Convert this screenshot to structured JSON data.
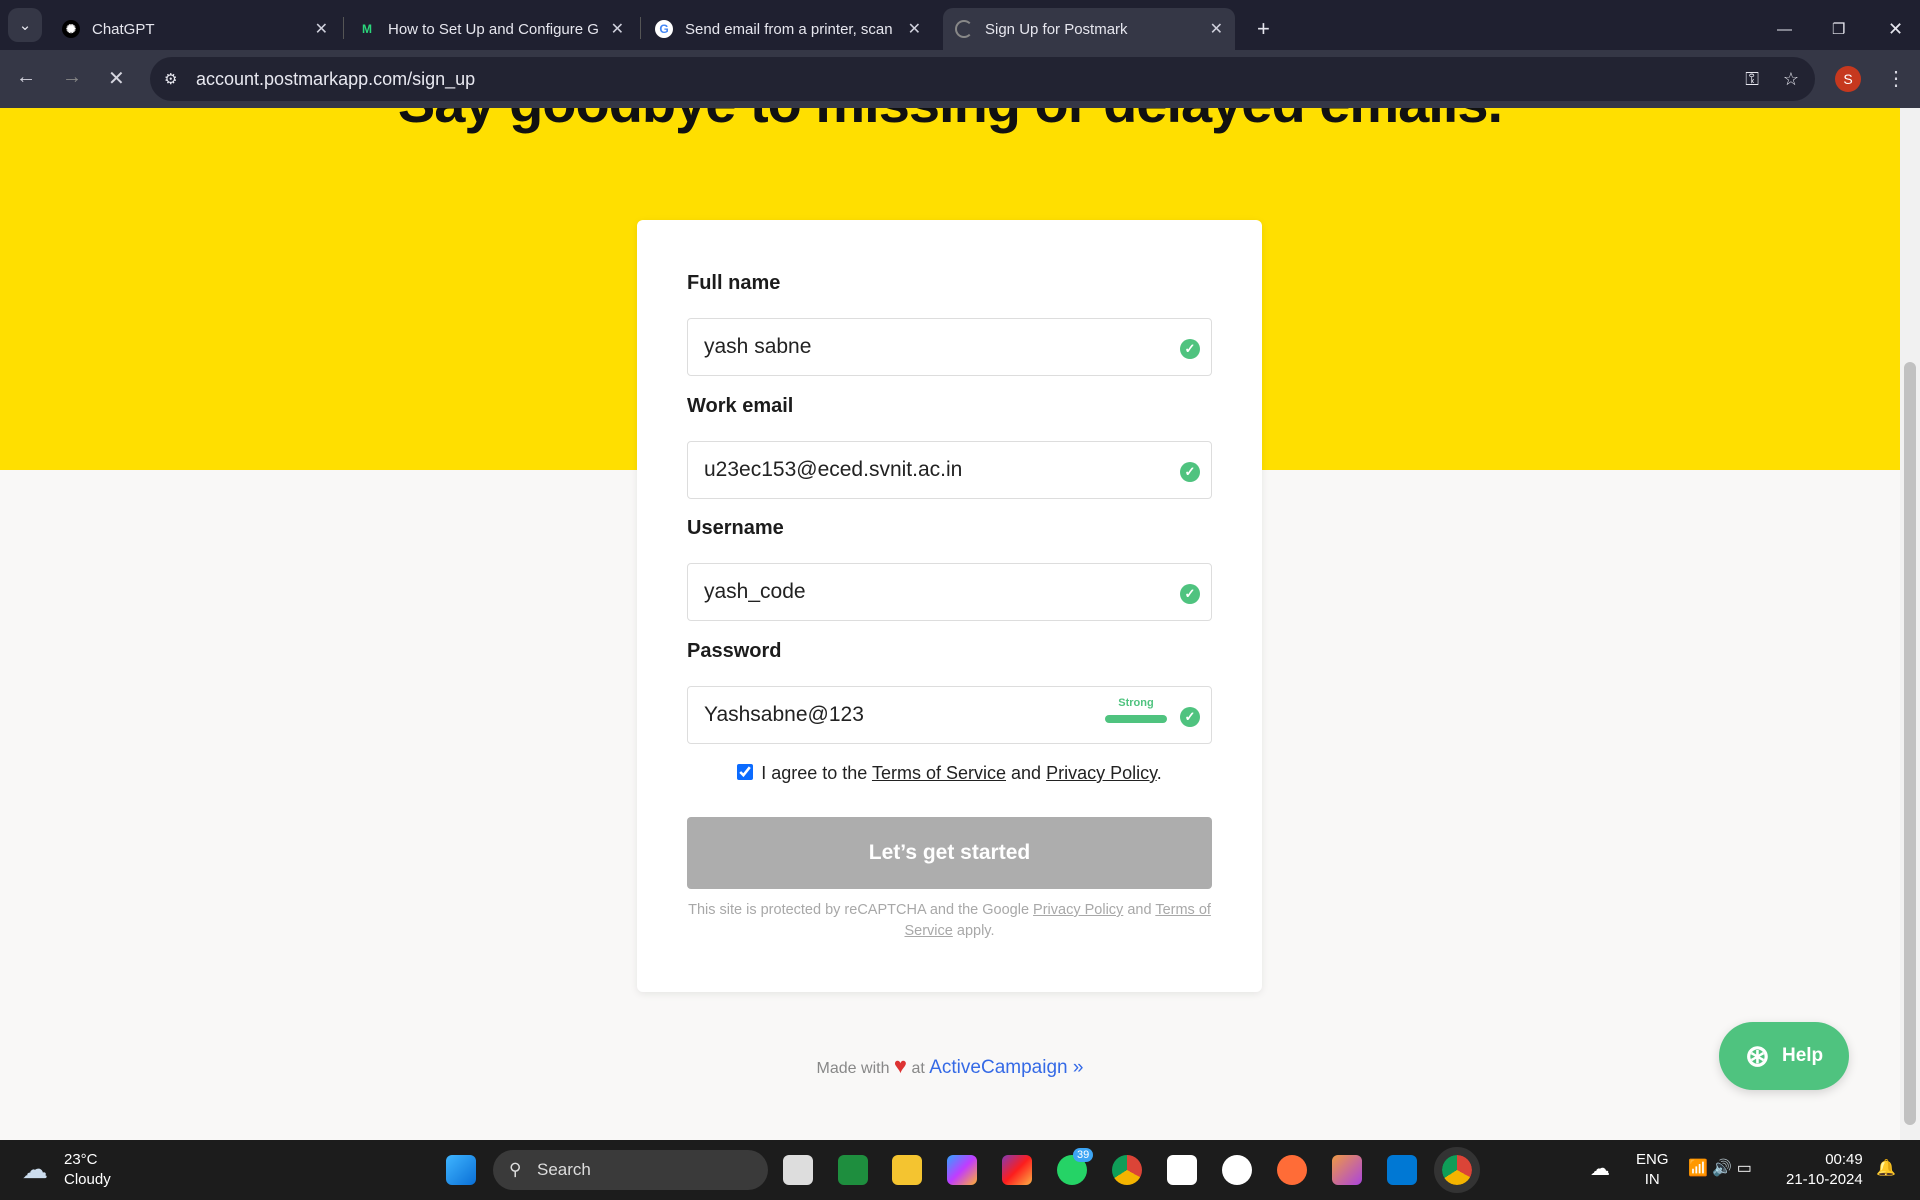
{
  "browser": {
    "tabs": [
      {
        "title": "ChatGPT",
        "icon": "chatgpt-icon"
      },
      {
        "title": "How to Set Up and Configure G",
        "icon": "gmail-icon"
      },
      {
        "title": "Send email from a printer, scan",
        "icon": "google-icon"
      },
      {
        "title": "Sign Up for Postmark",
        "icon": "loading-icon",
        "active": true
      }
    ],
    "url": "account.postmarkapp.com/sign_up",
    "profile_initial": "S"
  },
  "page": {
    "headline": "Say goodbye to missing or delayed emails.",
    "form": {
      "fields": [
        {
          "label": "Full name",
          "value": "yash sabne"
        },
        {
          "label": "Work email",
          "value": "u23ec153@eced.svnit.ac.in"
        },
        {
          "label": "Username",
          "value": "yash_code"
        },
        {
          "label": "Password",
          "value": "Yashsabne@123",
          "strength": "Strong"
        }
      ],
      "agree": {
        "checked": true,
        "prefix": "I agree to the",
        "terms": "Terms of Service",
        "and": "and",
        "privacy": "Privacy Policy",
        "suffix": "."
      },
      "submit": "Let’s get started",
      "recaptcha": {
        "prefix": "This site is protected by reCAPTCHA and the Google",
        "privacy": "Privacy Policy",
        "and": "and",
        "terms": "Terms of Service",
        "suffix": "apply."
      }
    },
    "footer": {
      "made_with": "Made with",
      "at": "at",
      "brand": "ActiveCampaign",
      "chevron": "»"
    },
    "help": "Help"
  },
  "taskbar": {
    "weather": {
      "temp": "23°C",
      "condition": "Cloudy"
    },
    "search": "Search",
    "whatsapp_badge": "39",
    "lang": "ENG",
    "region": "IN",
    "time": "00:49",
    "date": "21-10-2024"
  },
  "colors": {
    "yellow": "#ffdf00",
    "green": "#4fc37f",
    "link": "#356ae6"
  }
}
